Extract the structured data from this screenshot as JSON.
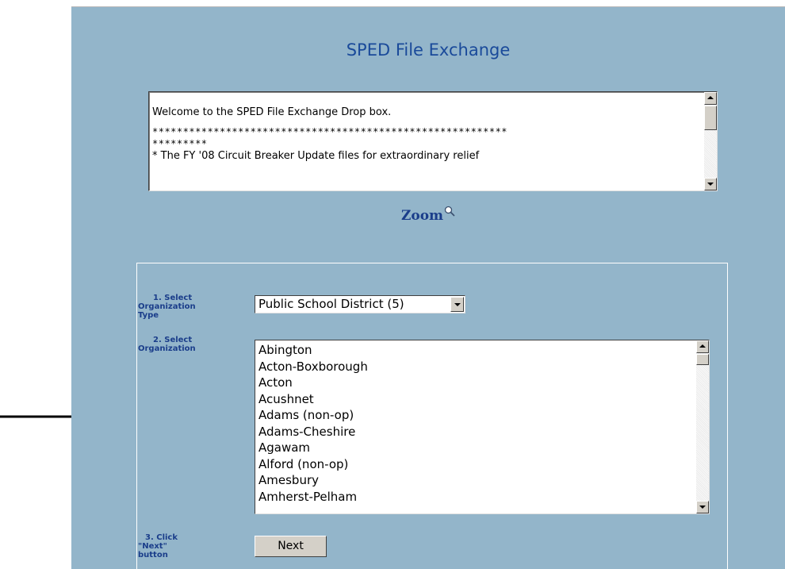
{
  "page": {
    "title": "SPED File Exchange"
  },
  "message_box": {
    "welcome": "Welcome to the SPED File Exchange Drop box.",
    "stars_line1": "**********************************************************",
    "stars_line2": "*********",
    "fy_line": "* The FY '08 Circuit Breaker Update files for extraordinary relief"
  },
  "zoom": {
    "label": "Zoom",
    "icon": "magnifier-icon"
  },
  "form": {
    "step1_label_line1": "1.  Select",
    "step1_label_line2": "Organization",
    "step1_label_line3": "Type",
    "step2_label_line1": "2.  Select",
    "step2_label_line2": "Organization",
    "step3_label_line1": "3.  Click",
    "step3_label_line2": "\"Next\" button",
    "org_type_selected": "Public School District (5)",
    "organizations": [
      "Abington",
      "Acton-Boxborough",
      "Acton",
      "Acushnet",
      "Adams (non-op)",
      "Adams-Cheshire",
      "Agawam",
      "Alford (non-op)",
      "Amesbury",
      "Amherst-Pelham"
    ],
    "next_label": "Next"
  },
  "colors": {
    "panel_bg": "#93b5ca",
    "title": "#1a4a9a",
    "label": "#1a3d8a"
  }
}
